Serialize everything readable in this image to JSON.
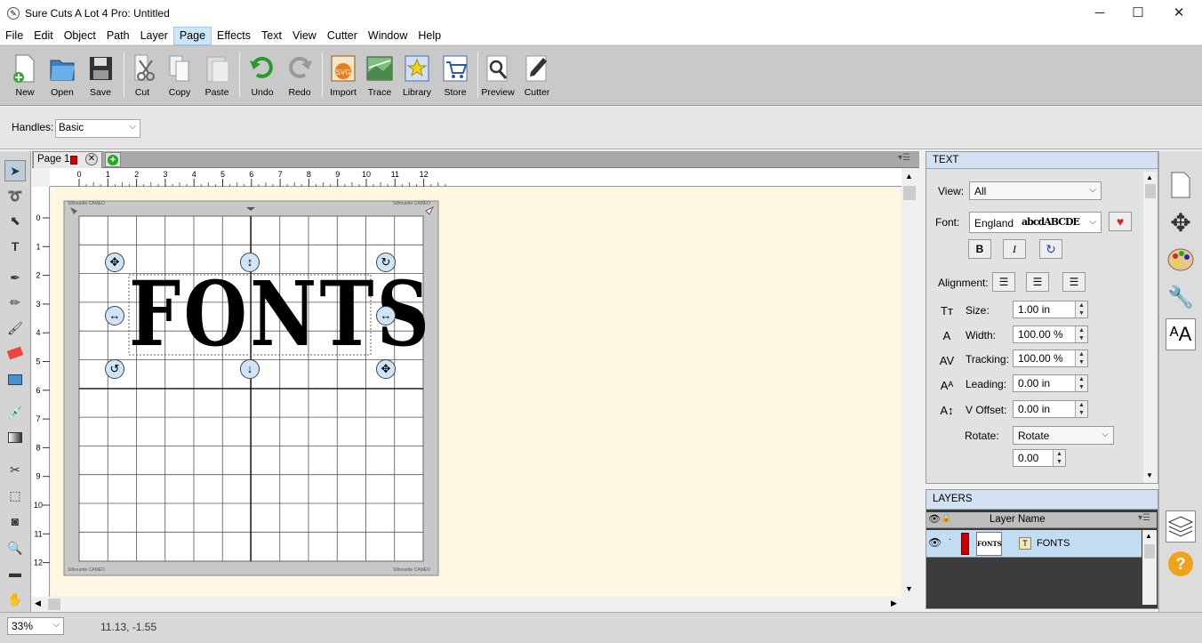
{
  "window": {
    "title": "Sure Cuts A Lot 4 Pro: Untitled",
    "minimize": "─",
    "maximize": "☐",
    "close": "✕"
  },
  "menu": [
    "File",
    "Edit",
    "Object",
    "Path",
    "Layer",
    "Page",
    "Effects",
    "Text",
    "View",
    "Cutter",
    "Window",
    "Help"
  ],
  "menu_active": "Page",
  "toolbar": [
    {
      "label": "New",
      "icon": "new-doc-icon"
    },
    {
      "label": "Open",
      "icon": "open-folder-icon"
    },
    {
      "label": "Save",
      "icon": "floppy-icon"
    },
    {
      "label": "Cut",
      "icon": "scissors-icon"
    },
    {
      "label": "Copy",
      "icon": "copy-icon"
    },
    {
      "label": "Paste",
      "icon": "paste-icon"
    },
    {
      "label": "Undo",
      "icon": "undo-icon"
    },
    {
      "label": "Redo",
      "icon": "redo-icon"
    },
    {
      "label": "Import",
      "icon": "svg-import-icon"
    },
    {
      "label": "Trace",
      "icon": "trace-icon"
    },
    {
      "label": "Library",
      "icon": "star-library-icon"
    },
    {
      "label": "Store",
      "icon": "cart-icon"
    },
    {
      "label": "Preview",
      "icon": "magnifier-icon"
    },
    {
      "label": "Cutter",
      "icon": "pen-cutter-icon"
    }
  ],
  "handles": {
    "label": "Handles:",
    "value": "Basic"
  },
  "page_tab": {
    "label": "Page 1"
  },
  "ruler": {
    "h_ticks": [
      "0",
      "1",
      "2",
      "3",
      "4",
      "5",
      "6",
      "7",
      "8",
      "9",
      "10",
      "11",
      "12"
    ],
    "v_ticks": [
      "0",
      "1",
      "2",
      "3",
      "4",
      "5",
      "6",
      "7",
      "8",
      "9",
      "10",
      "11",
      "12"
    ]
  },
  "mat": {
    "corner_text": "Silhouette CAMEO",
    "design_text": "FONTS"
  },
  "status": {
    "zoom": "33%",
    "coords": "11.13, -1.55"
  },
  "text_panel": {
    "header": "TEXT",
    "view_label": "View:",
    "view_value": "All",
    "font_label": "Font:",
    "font_value": "England",
    "font_preview": "abcdABCDE",
    "bold": "B",
    "italic": "I",
    "alignment_label": "Alignment:",
    "size_label": "Size:",
    "size_value": "1.00 in",
    "width_label": "Width:",
    "width_value": "100.00 %",
    "tracking_label": "Tracking:",
    "tracking_value": "100.00 %",
    "leading_label": "Leading:",
    "leading_value": "0.00 in",
    "voffset_label": "V Offset:",
    "voffset_value": "0.00 in",
    "rotate_label": "Rotate:",
    "rotate_value": "Rotate",
    "rotate_angle": "0.00"
  },
  "layers_panel": {
    "header": "LAYERS",
    "column": "Layer Name",
    "rows": [
      {
        "name": "FONTS",
        "thumb": "FONTS",
        "color": "#cc0000"
      }
    ]
  },
  "colors": {
    "accent": "#cc0000",
    "canvas": "#fdf6e0",
    "panel_header": "#d2e2f2",
    "selected_row": "#c2dcf2"
  }
}
